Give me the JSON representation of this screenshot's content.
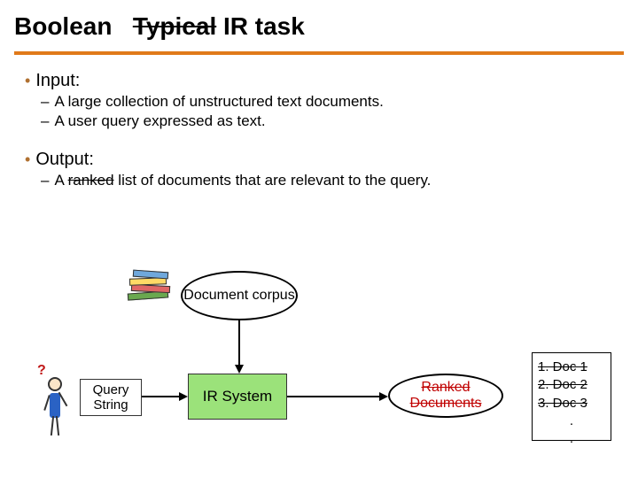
{
  "title": {
    "word1": "Boolean",
    "strike": "Typical",
    "rest": "IR task"
  },
  "bullets": {
    "input": {
      "label": "Input:",
      "items": [
        "A large collection of unstructured text documents.",
        "A user query expressed as text."
      ]
    },
    "output": {
      "label": "Output:",
      "item_prefix": "A ",
      "item_strike": "ranked",
      "item_suffix": " list of documents that are relevant to the query."
    }
  },
  "diagram": {
    "doc_corpus": "Document corpus",
    "query_box": "Query String",
    "ir_box": "IR System",
    "ranked_docs": "Ranked Documents",
    "doclist": {
      "r1": "1. Doc 1",
      "r2": "2. Doc 2",
      "r3": "3. Doc 3",
      "dot": "."
    }
  }
}
